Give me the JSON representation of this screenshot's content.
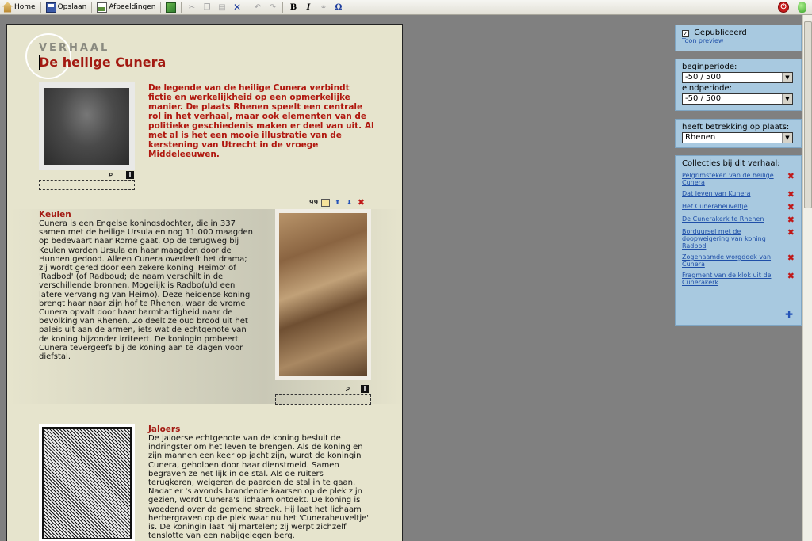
{
  "toolbar": {
    "home": "Home",
    "save": "Opslaan",
    "images": "Afbeeldingen",
    "bold": "B",
    "italic": "I",
    "omega": "Ω"
  },
  "page": {
    "kicker": "VERHAAL",
    "title": "De heilige Cunera",
    "intro": "De legende van de heilige Cunera verbindt fictie en werkelijkheid op een opmerkelijke manier. De plaats Rhenen speelt een centrale rol in het verhaal, maar ook elementen van de politieke geschiedenis maken er deel van uit. Al met al is het een mooie illustratie van de kerstening van Utrecht in de vroege Middeleeuwen."
  },
  "sections": [
    {
      "heading": "Keulen",
      "body": "Cunera is een Engelse koningsdochter, die in 337 samen met de heilige Ursula en nog 11.000 maagden op bedevaart naar Rome gaat. Op de terugweg bij Keulen worden Ursula en haar maagden door de Hunnen gedood. Alleen Cunera overleeft het drama; zij wordt gered door een zekere koning 'Heimo' of 'Radbod' (of Radboud; de naam verschilt in de verschillende bronnen. Mogelijk is Radbo(u)d een latere vervanging van Heimo). Deze heidense koning brengt haar naar zijn hof te Rhenen, waar de vrome Cunera opvalt door haar barmhartigheid naar de bevolking van Rhenen. Zo deelt ze oud brood uit het paleis uit aan de armen, iets wat de echtgenote van de koning bijzonder irriteert. De koningin probeert Cunera tevergeefs bij de koning aan te klagen voor diefstal.",
      "tool_num": "99"
    },
    {
      "heading": "Jaloers",
      "body": "De jaloerse echtgenote van de koning besluit de indringster om het leven te brengen. Als de koning en zijn mannen een keer op jacht zijn, wurgt de koningin Cunera, geholpen door haar dienstmeid. Samen begraven ze het lijk in de stal. Als de ruiters terugkeren, weigeren de paarden de stal in te gaan. Nadat er 's avonds brandende kaarsen op de plek zijn gezien, wordt Cunera's lichaam ontdekt. De koning is woedend over de gemene streek. Hij laat het lichaam herbergraven op de plek waar nu het 'Cuneraheuveltje' is. De koningin laat hij martelen; zij werpt zichzelf tenslotte van een nabijgelegen berg."
    }
  ],
  "sidebar": {
    "published_label": "Gepubliceerd",
    "published_checked": true,
    "preview_link": "Toon preview",
    "begin_label": "beginperiode:",
    "begin_value": "-50 / 500",
    "end_label": "eindperiode:",
    "end_value": "-50 / 500",
    "place_label": "heeft betrekking op plaats:",
    "place_value": "Rhenen",
    "collections_label": "Collecties bij dit verhaal:",
    "collections": [
      "Pelgrimsteken van de heilige Cunera",
      "Dat leven van Kunera",
      "Het Cuneraheuveltje",
      "De Cunerakerk te Rhenen",
      "Borduursel met de doopweigering van koning Radbod",
      "Zogenaamde worgdoek van Cunera",
      "Fragment van de klok uit de Cunerakerk"
    ]
  }
}
